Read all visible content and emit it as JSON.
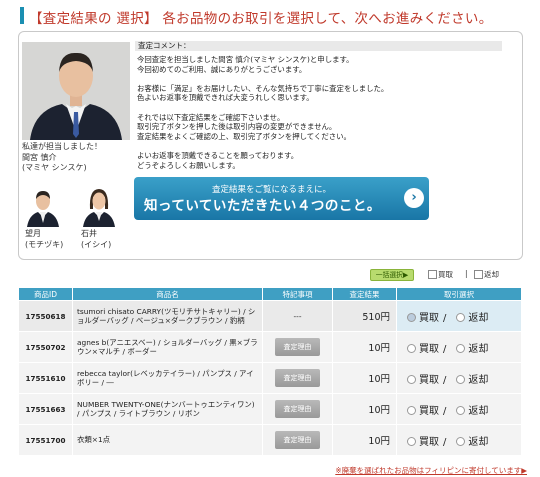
{
  "page_title": "【査定結果の 選択】 各お品物のお取引を選択して、次へお進みください。",
  "staff": {
    "main_caption": "私達が担当しました！",
    "main_name": "間宮 慎介",
    "main_reading": "(マミヤ シンスケ)",
    "left_name": "望月",
    "left_reading": "(モチヅキ)",
    "right_name": "石井",
    "right_reading": "(イシイ)"
  },
  "comment": {
    "heading": "査定コメント：",
    "p1": [
      "今回査定を担当しました間宮 慎介(マミヤ シンスケ)と申します。",
      "今回初めてのご利用、誠にありがとうございます。"
    ],
    "p2": [
      "お客様に「満足」をお届けしたい、そんな気持ちで丁寧に査定をしました。",
      "色よいお返事を頂戴できれば大変うれしく思います。"
    ],
    "p3": [
      "それでは以下査定結果をご確認下さいませ。",
      "取引完了ボタンを押した後は取引内容の変更ができません。",
      "査定結果をよくご確認の上、取引完了ボタンを押してください。"
    ],
    "p4": [
      "よいお返事を頂戴できることを願っております。",
      "どうぞよろしくお願いします。"
    ]
  },
  "banner": {
    "line1": "査定結果をご覧になるまえに。",
    "line2": "知っていていただきたい４つのこと。",
    "arrow": "›"
  },
  "bulk": {
    "label": "一括選択▶",
    "option1": "買取",
    "option2": "返却"
  },
  "table": {
    "headers": [
      "商品ID",
      "商品名",
      "特記事項",
      "査定結果",
      "取引選択"
    ],
    "rows": [
      {
        "id": "17550618",
        "name": "tsumori chisato CARRY(ツモリチサトキャリー) / ショルダーバッグ / ベージュ×ダークブラウン / 豹柄",
        "note": "---",
        "price": "510円",
        "buy": "買取",
        "ret": "返却"
      },
      {
        "id": "17550702",
        "name": "agnes b(アニエスベー) / ショルダーバッグ / 黒×ブラウン×マルチ / ボーダー",
        "note": "査定理由",
        "price": "10円",
        "buy": "買取",
        "ret": "返却"
      },
      {
        "id": "17551610",
        "name": "rebecca taylor(レベッカテイラー) / パンプス / アイボリー / ―",
        "note": "査定理由",
        "price": "10円",
        "buy": "買取",
        "ret": "返却"
      },
      {
        "id": "17551663",
        "name": "NUMBER TWENTY-ONE(ナンバートゥエンティワン) / パンプス / ライトブラウン / リボン",
        "note": "査定理由",
        "price": "10円",
        "buy": "買取",
        "ret": "返却"
      },
      {
        "id": "17551700",
        "name": "衣類×1点",
        "note": "査定理由",
        "price": "10円",
        "buy": "買取",
        "ret": "返却"
      }
    ]
  },
  "notice": "※廃棄を選ばれたお品物はフィリピンに寄付しています▶"
}
